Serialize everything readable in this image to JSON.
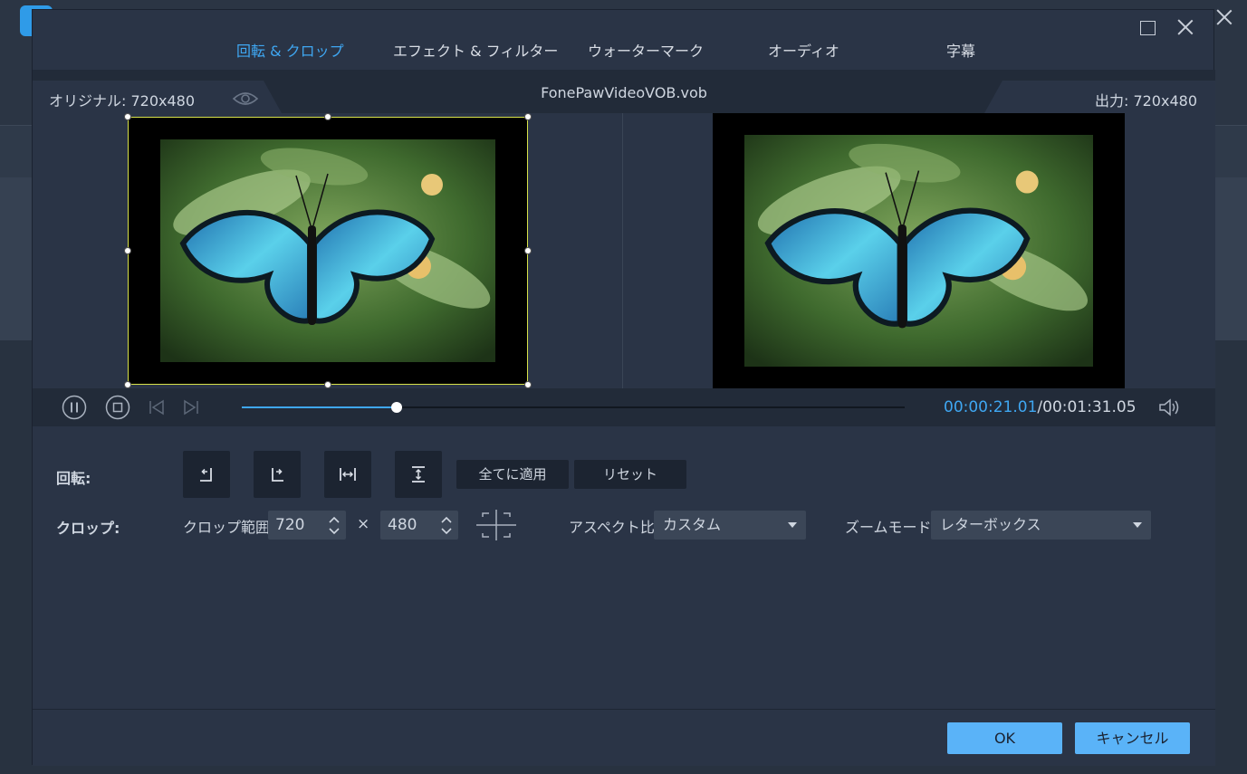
{
  "tabs": [
    {
      "label": "回転 & クロップ",
      "active": true
    },
    {
      "label": "エフェクト & フィルター",
      "active": false
    },
    {
      "label": "ウォーターマーク",
      "active": false
    },
    {
      "label": "オーディオ",
      "active": false
    },
    {
      "label": "字幕",
      "active": false
    }
  ],
  "header": {
    "original_label": "オリジナル: 720x480",
    "file_name": "FonePawVideoVOB.vob",
    "output_label": "出力: 720x480"
  },
  "playback": {
    "current_time": "00:00:21.01",
    "separator": "/",
    "total_time": "00:01:31.05",
    "progress": 0.233
  },
  "rotate": {
    "label": "回転:",
    "apply_all": "全てに適用",
    "reset": "リセット"
  },
  "crop": {
    "label": "クロップ:",
    "range_label": "クロップ範囲:",
    "width": "720",
    "height": "480",
    "times": "×",
    "aspect_label": "アスペクト比:",
    "aspect_value": "カスタム",
    "zoom_label": "ズームモード:",
    "zoom_value": "レターボックス"
  },
  "footer": {
    "ok": "OK",
    "cancel": "キャンセル"
  },
  "colors": {
    "accent": "#3fa7f2",
    "crop_border": "#d8e24a",
    "button_primary": "#5ab3f8"
  }
}
